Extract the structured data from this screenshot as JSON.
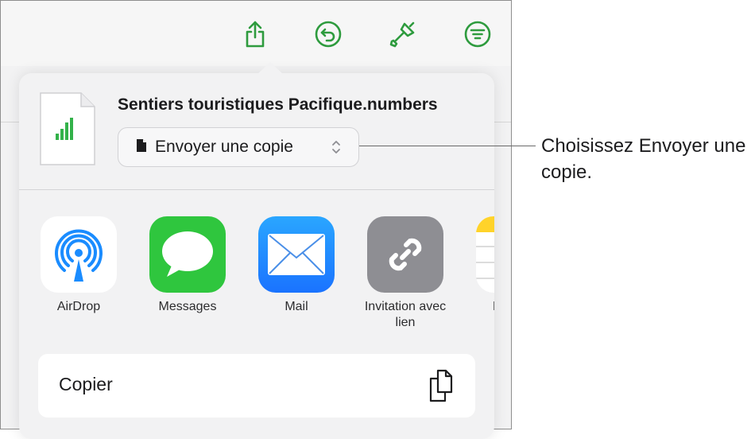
{
  "toolbar": {
    "buttons": [
      {
        "name": "share",
        "icon": "share-icon"
      },
      {
        "name": "undo",
        "icon": "undo-icon"
      },
      {
        "name": "format",
        "icon": "paintbrush-icon"
      },
      {
        "name": "organize",
        "icon": "filter-icon"
      }
    ],
    "accent_color": "#2e9b3e"
  },
  "share_sheet": {
    "file_title": "Sentiers touristiques Pacifique.numbers",
    "send_option": "Envoyer une copie",
    "apps": [
      {
        "label": "AirDrop",
        "icon": "airdrop-icon"
      },
      {
        "label": "Messages",
        "icon": "messages-icon"
      },
      {
        "label": "Mail",
        "icon": "mail-icon"
      },
      {
        "label": "Invitation avec lien",
        "icon": "link-icon"
      },
      {
        "label": "N",
        "icon": "notes-icon"
      }
    ],
    "actions": [
      {
        "label": "Copier",
        "icon": "copy-icon"
      }
    ]
  },
  "callout": {
    "text": "Choisissez Envoyer une copie."
  }
}
